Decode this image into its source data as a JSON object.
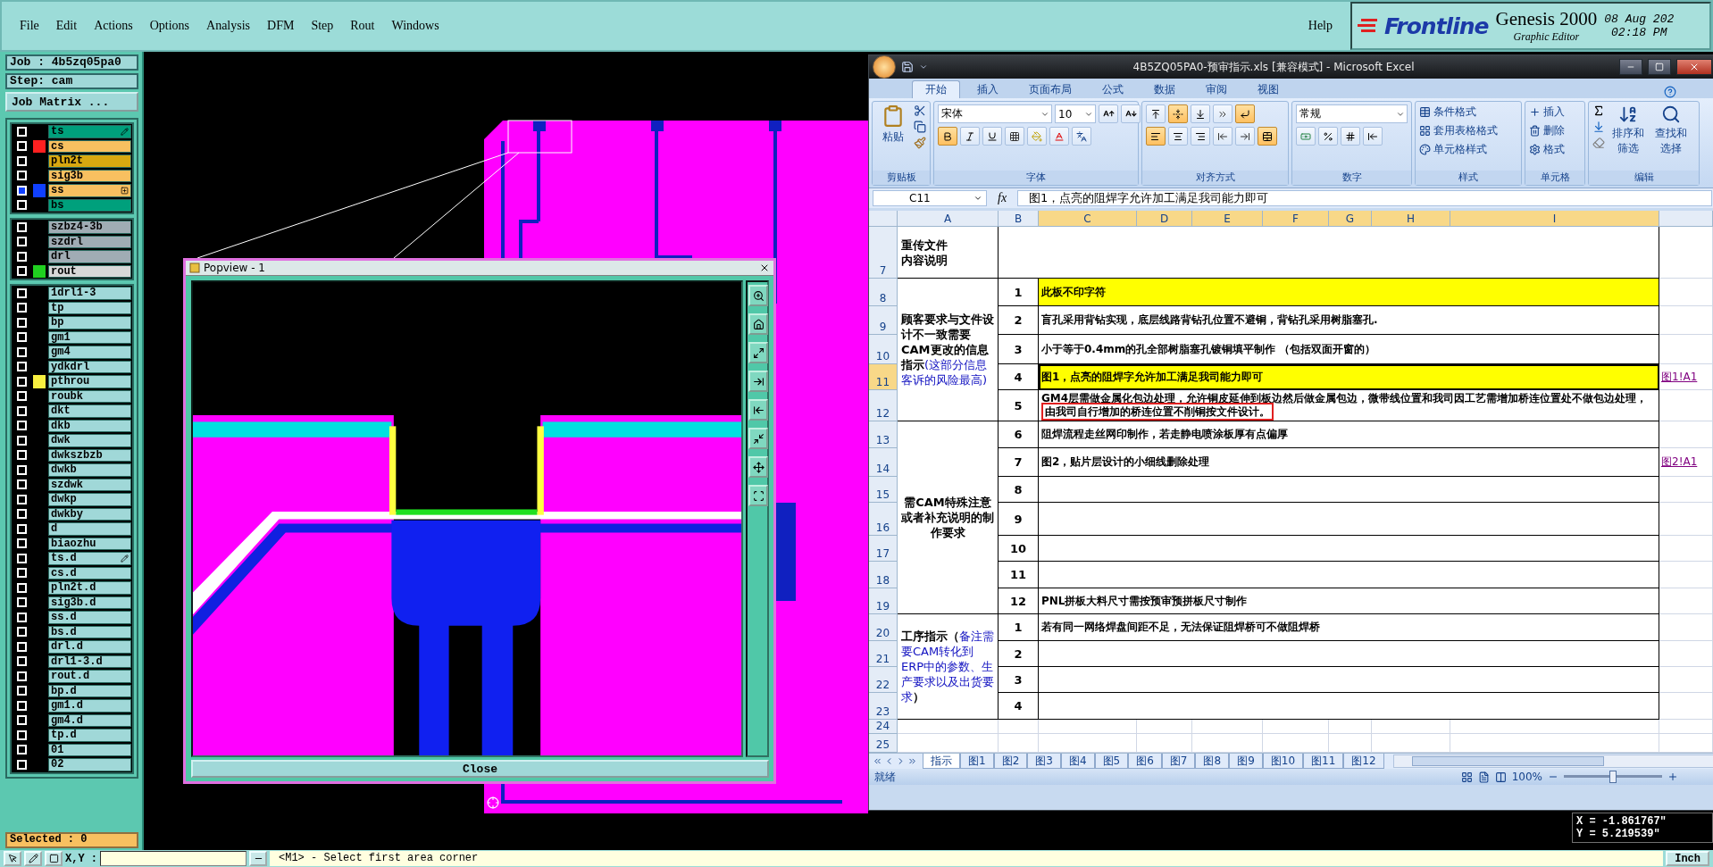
{
  "menu_bar": {
    "items": [
      "File",
      "Edit",
      "Actions",
      "Options",
      "Analysis",
      "DFM",
      "Step",
      "Rout",
      "Windows"
    ],
    "help": "Help",
    "brand": {
      "logo": "Frontline",
      "product": "Genesis 2000",
      "subtitle": "Graphic Editor",
      "date": "08 Aug 202",
      "time": "02:18 PM"
    }
  },
  "job_panel": {
    "job": "Job : 4b5zq05pa0",
    "step": "Step: cam",
    "matrix_button": "Job Matrix ...",
    "selected_count": "Selected : 0",
    "layer_groups": [
      {
        "layers": [
          {
            "name": "ts",
            "color": "#00a07c",
            "active": false,
            "kind": "pen"
          },
          {
            "name": "cs",
            "color": "#f8c060",
            "active": false,
            "swatch": {
              "color": "#ff2020"
            }
          },
          {
            "name": "pln2t",
            "color": "#d8a810",
            "active": false
          },
          {
            "name": "sig3b",
            "color": "#f8c060",
            "active": false
          },
          {
            "name": "ss",
            "color": "#f8c060",
            "active": true,
            "swatch": {
              "color": "#1040ff"
            },
            "kind": "grid"
          },
          {
            "name": "bs",
            "color": "#00a07c",
            "active": false
          }
        ]
      },
      {
        "layers": [
          {
            "name": "szbz4-3b",
            "color": "#a0acb4",
            "active": false
          },
          {
            "name": "szdrl",
            "color": "#a0acb4",
            "active": false
          },
          {
            "name": "drl",
            "color": "#a0acb4",
            "active": false
          },
          {
            "name": "rout",
            "color": "#d8d8d8",
            "active": false,
            "swatch": {
              "color": "#20d020"
            }
          }
        ]
      },
      {
        "layers": [
          {
            "name": "1drl1-3",
            "color": "#a0d8d8",
            "active": false
          },
          {
            "name": "tp",
            "color": "#a0d8d8",
            "active": false
          },
          {
            "name": "bp",
            "color": "#a0d8d8",
            "active": false
          },
          {
            "name": "gm1",
            "color": "#a0d8d8",
            "active": false
          },
          {
            "name": "gm4",
            "color": "#a0d8d8",
            "active": false
          },
          {
            "name": "ydkdrl",
            "color": "#a0d8d8",
            "active": false
          },
          {
            "name": "pthrou",
            "color": "#a0d8d8",
            "active": false,
            "swatch": {
              "color": "#f8f040"
            }
          },
          {
            "name": "roubk",
            "color": "#a0d8d8",
            "active": false
          },
          {
            "name": "dkt",
            "color": "#a0d8d8",
            "active": false
          },
          {
            "name": "dkb",
            "color": "#a0d8d8",
            "active": false
          },
          {
            "name": "dwk",
            "color": "#a0d8d8",
            "active": false
          },
          {
            "name": "dwkszbzb",
            "color": "#a0d8d8",
            "active": false
          },
          {
            "name": "dwkb",
            "color": "#a0d8d8",
            "active": false
          },
          {
            "name": "szdwk",
            "color": "#a0d8d8",
            "active": false
          },
          {
            "name": "dwkp",
            "color": "#a0d8d8",
            "active": false
          },
          {
            "name": "dwkby",
            "color": "#a0d8d8",
            "active": false
          },
          {
            "name": "d",
            "color": "#a0d8d8",
            "active": false
          },
          {
            "name": "biaozhu",
            "color": "#a0d8d8",
            "active": false
          },
          {
            "name": "ts.d",
            "color": "#a0d8d8",
            "active": false,
            "kind": "pen"
          },
          {
            "name": "cs.d",
            "color": "#a0d8d8",
            "active": false
          },
          {
            "name": "pln2t.d",
            "color": "#a0d8d8",
            "active": false
          },
          {
            "name": "sig3b.d",
            "color": "#a0d8d8",
            "active": false
          },
          {
            "name": "ss.d",
            "color": "#a0d8d8",
            "active": false
          },
          {
            "name": "bs.d",
            "color": "#a0d8d8",
            "active": false
          },
          {
            "name": "drl.d",
            "color": "#a0d8d8",
            "active": false
          },
          {
            "name": "drl1-3.d",
            "color": "#a0d8d8",
            "active": false
          },
          {
            "name": "rout.d",
            "color": "#a0d8d8",
            "active": false
          },
          {
            "name": "bp.d",
            "color": "#a0d8d8",
            "active": false
          },
          {
            "name": "gm1.d",
            "color": "#a0d8d8",
            "active": false
          },
          {
            "name": "gm4.d",
            "color": "#a0d8d8",
            "active": false
          },
          {
            "name": "tp.d",
            "color": "#a0d8d8",
            "active": false
          },
          {
            "name": "01",
            "color": "#a0d8d8",
            "active": false
          },
          {
            "name": "02",
            "color": "#a0d8d8",
            "active": false
          }
        ]
      }
    ]
  },
  "popview": {
    "title": "Popview - 1",
    "close_button": "Close"
  },
  "excel": {
    "title": "4B5ZQ05PA0-预审指示.xls  [兼容模式] - Microsoft Excel",
    "tabs": [
      {
        "label": "开始",
        "selected": true
      },
      {
        "label": "插入",
        "selected": false
      },
      {
        "label": "页面布局",
        "selected": false
      },
      {
        "label": "公式",
        "selected": false
      },
      {
        "label": "数据",
        "selected": false
      },
      {
        "label": "审阅",
        "selected": false
      },
      {
        "label": "视图",
        "selected": false
      }
    ],
    "ribbon": {
      "clipboard": {
        "label": "剪贴板",
        "paste": "粘贴"
      },
      "font": {
        "label": "字体",
        "name": "宋体",
        "size": "10",
        "bold": true,
        "italic": false,
        "underline": false
      },
      "alignment": {
        "label": "对齐方式",
        "vertical": [
          {
            "selected": false
          },
          {
            "selected": true
          },
          {
            "selected": false
          }
        ],
        "horizontal": [
          {
            "selected": true
          },
          {
            "selected": false
          },
          {
            "selected": false
          }
        ],
        "wrap_text": true,
        "merge": true
      },
      "number": {
        "label": "数字",
        "format": "常规"
      },
      "styles": {
        "label": "样式",
        "buttons": [
          "条件格式",
          "套用表格格式",
          "单元格样式"
        ]
      },
      "cells": {
        "label": "单元格",
        "buttons": [
          "插入",
          "删除",
          "格式"
        ]
      },
      "editing": {
        "label": "编辑",
        "buttons": [
          "排序和筛选",
          "查找和选择"
        ]
      }
    },
    "formula_bar": {
      "cell": "C11",
      "fx": "fx",
      "formula": "图1，点亮的阻焊字允许加工满足我司能力即可"
    },
    "columns": [
      {
        "label": "A",
        "selected": false
      },
      {
        "label": "B",
        "selected": false
      },
      {
        "label": "C",
        "selected": true
      },
      {
        "label": "D",
        "selected": true
      },
      {
        "label": "E",
        "selected": true
      },
      {
        "label": "F",
        "selected": true
      },
      {
        "label": "G",
        "selected": true
      },
      {
        "label": "H",
        "selected": true
      },
      {
        "label": "I",
        "selected": true
      }
    ],
    "rows": [
      {
        "number": "7",
        "selected": false
      },
      {
        "number": "8",
        "selected": false
      },
      {
        "number": "9",
        "selected": false
      },
      {
        "number": "10",
        "selected": false
      },
      {
        "number": "11",
        "selected": true
      },
      {
        "number": "12",
        "selected": false
      },
      {
        "number": "13",
        "selected": false
      },
      {
        "number": "14",
        "selected": false
      },
      {
        "number": "15",
        "selected": false
      },
      {
        "number": "16",
        "selected": false
      },
      {
        "number": "17",
        "selected": false
      },
      {
        "number": "18",
        "selected": false
      },
      {
        "number": "19",
        "selected": false
      },
      {
        "number": "20",
        "selected": false
      },
      {
        "number": "21",
        "selected": false
      },
      {
        "number": "22",
        "selected": false
      },
      {
        "number": "23",
        "selected": false
      },
      {
        "number": "24",
        "selected": false
      },
      {
        "number": "25",
        "selected": false
      }
    ],
    "sections": [
      {
        "kind": "title",
        "lines": [
          "重传文件",
          "内容说明"
        ]
      },
      {
        "kind": "noted",
        "label": "顾客要求与文件设计不一致需要CAM更改的信息指示",
        "note": "(这部分信息客诉的风险最高)",
        "items": [
          {
            "number": "1",
            "text": "此板不印字符",
            "highlighted": true,
            "selected": false
          },
          {
            "number": "2",
            "text": "盲孔采用背钻实现，底层线路背钻孔位置不避铜，背钻孔采用树脂塞孔.",
            "highlighted": false,
            "selected": false
          },
          {
            "number": "3",
            "text": "小于等于0.4mm的孔全部树脂塞孔镀铜填平制作 （包括双面开窗的）",
            "highlighted": false,
            "selected": false
          },
          {
            "number": "4",
            "text": "图1，点亮的阻焊字允许加工满足我司能力即可",
            "highlighted": true,
            "selected": true,
            "link": "图1!A1"
          },
          {
            "number": "5",
            "text": "GM4层需做金属化包边处理，允许铜皮延伸到板边然后做金属包边，微带线位置和我司因工艺需增加桥连位置处不做包边处理，",
            "boxed": "由我司自行增加的桥连位置不削铜按文件设计。",
            "highlighted": false,
            "selected": false
          }
        ]
      },
      {
        "kind": "centered",
        "label": "需CAM特殊注意或者补充说明的制作要求",
        "items": [
          {
            "number": "6",
            "text": "阻焊流程走丝网印制作，若走静电喷涂板厚有点偏厚",
            "highlighted": false,
            "selected": false
          },
          {
            "number": "7",
            "text": "图2，贴片层设计的小细线删除处理",
            "highlighted": false,
            "selected": false,
            "link": "图2!A1"
          },
          {
            "number": "8",
            "highlighted": false,
            "selected": false
          },
          {
            "number": "9",
            "highlighted": false,
            "selected": false
          },
          {
            "number": "10",
            "highlighted": false,
            "selected": false
          },
          {
            "number": "11",
            "highlighted": false,
            "selected": false
          },
          {
            "number": "12",
            "text": "PNL拼板大料尺寸需按预审预拼板尺寸制作",
            "highlighted": false,
            "selected": false
          }
        ]
      },
      {
        "kind": "noted",
        "label": "工序指示（",
        "note": "备注需要CAM转化到ERP中的参数、生产要求以及出货要求",
        "label_end": "）",
        "items": [
          {
            "number": "1",
            "text": "若有同一网络焊盘间距不足，无法保证阻焊桥可不做阻焊桥",
            "highlighted": false,
            "selected": false
          },
          {
            "number": "2",
            "highlighted": false,
            "selected": false
          },
          {
            "number": "3",
            "highlighted": false,
            "selected": false
          },
          {
            "number": "4",
            "highlighted": false,
            "selected": false
          }
        ]
      }
    ],
    "sheet_tabs": [
      {
        "label": "指示",
        "selected": true
      },
      {
        "label": "图1",
        "selected": false
      },
      {
        "label": "图2",
        "selected": false
      },
      {
        "label": "图3",
        "selected": false
      },
      {
        "label": "图4",
        "selected": false
      },
      {
        "label": "图5",
        "selected": false
      },
      {
        "label": "图6",
        "selected": false
      },
      {
        "label": "图7",
        "selected": false
      },
      {
        "label": "图8",
        "selected": false
      },
      {
        "label": "图9",
        "selected": false
      },
      {
        "label": "图10",
        "selected": false
      },
      {
        "label": "图11",
        "selected": false
      },
      {
        "label": "图12",
        "selected": false
      }
    ],
    "status": "就绪",
    "zoom": "100%",
    "zoom_slider": {
      "level": 0.5
    }
  },
  "coordinates": {
    "x": "X = -1.861767\"",
    "y": "Y = 5.219539\""
  },
  "status_bar": {
    "xy_label": "X,Y :",
    "prompt": "<M1> - Select first area corner",
    "units": "Inch"
  }
}
